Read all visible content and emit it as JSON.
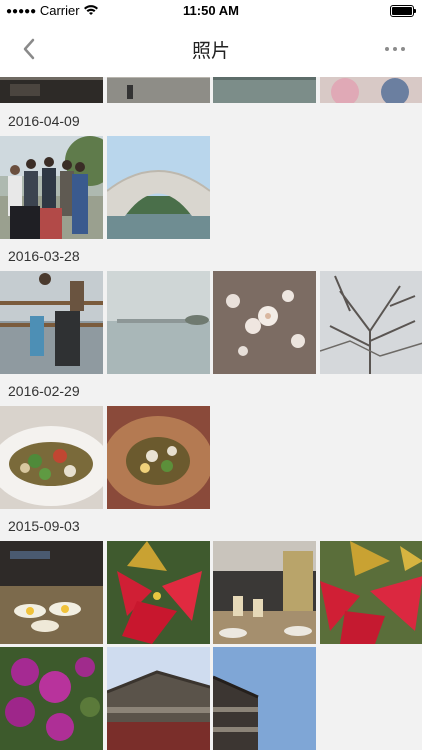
{
  "status": {
    "carrier": "Carrier",
    "time": "11:50 AM"
  },
  "nav": {
    "title": "照片"
  },
  "sections": [
    {
      "date": "2016-04-09"
    },
    {
      "date": "2016-03-28"
    },
    {
      "date": "2016-02-29"
    },
    {
      "date": "2015-09-03"
    }
  ],
  "icons": [
    "signal-dots-icon",
    "wifi-icon",
    "battery-icon",
    "back-chevron-icon",
    "more-icon"
  ]
}
